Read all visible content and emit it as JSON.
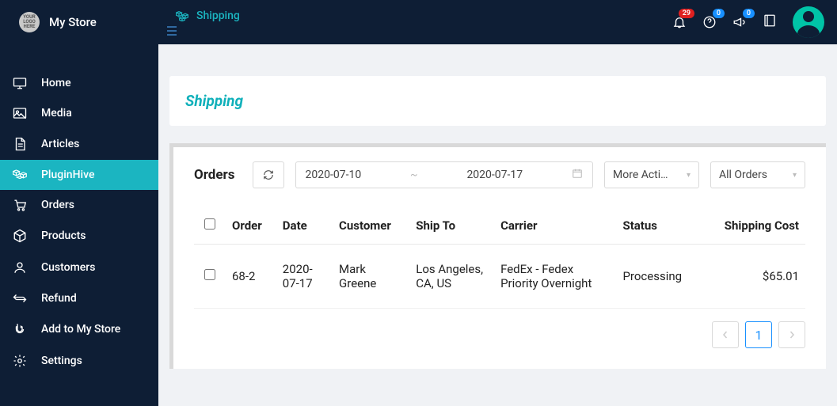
{
  "store": {
    "name": "My Store",
    "logo_text": "YOUR LOGO HERE"
  },
  "top_link": {
    "label": "Shipping"
  },
  "badges": {
    "notifications": "29",
    "help": "0",
    "announce": "0"
  },
  "sidebar": {
    "items": [
      {
        "label": "Home"
      },
      {
        "label": "Media"
      },
      {
        "label": "Articles"
      },
      {
        "label": "PluginHive"
      },
      {
        "label": "Orders"
      },
      {
        "label": "Products"
      },
      {
        "label": "Customers"
      },
      {
        "label": "Refund"
      },
      {
        "label": "Add to My Store"
      },
      {
        "label": "Settings"
      }
    ]
  },
  "page": {
    "title": "Shipping"
  },
  "orders_panel": {
    "heading": "Orders",
    "date_from": "2020-07-10",
    "date_to": "2020-07-17",
    "date_sep": "~",
    "actions_label": "More Acti…",
    "filter_label": "All Orders"
  },
  "table": {
    "headers": {
      "order": "Order",
      "date": "Date",
      "customer": "Customer",
      "ship_to": "Ship To",
      "carrier": "Carrier",
      "status": "Status",
      "cost": "Shipping Cost"
    },
    "rows": [
      {
        "order": "68-2",
        "date": "2020-07-17",
        "customer": "Mark Greene",
        "ship_to": "Los Angeles, CA, US",
        "carrier": "FedEx - Fedex Priority Overnight",
        "status": "Processing",
        "cost": "$65.01"
      }
    ]
  },
  "pager": {
    "current": "1"
  }
}
